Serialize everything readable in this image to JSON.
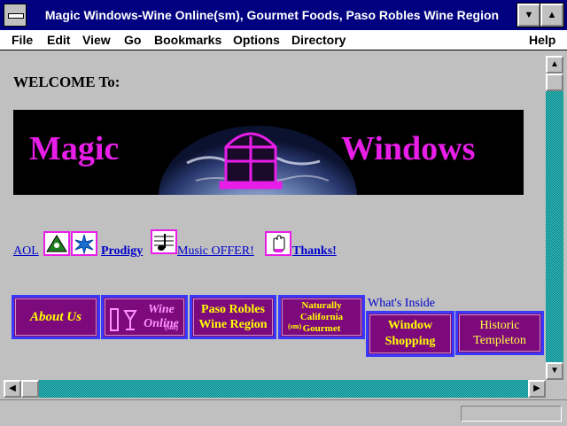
{
  "window": {
    "title": "Magic Windows-Wine Online(sm), Gourmet Foods, Paso Robles Wine Region"
  },
  "menu": {
    "items": [
      {
        "label": "File"
      },
      {
        "label": "Edit"
      },
      {
        "label": "View"
      },
      {
        "label": "Go"
      },
      {
        "label": "Bookmarks"
      },
      {
        "label": "Options"
      },
      {
        "label": "Directory"
      },
      {
        "label": "Help"
      }
    ]
  },
  "page": {
    "welcome": "WELCOME To:",
    "banner": {
      "left_word": "Magic",
      "right_word": "Windows"
    },
    "links": {
      "aol": "AOL",
      "prodigy": "Prodigy",
      "music_offer": "Music OFFER!",
      "thanks": "Thanks!"
    },
    "whats_inside": "What's Inside",
    "nav": {
      "about": "About Us",
      "wine_online": "Wine Online",
      "wine_online_sm": "(sm)",
      "paso_robles": "Paso Robles Wine Region",
      "naturally_california": "Naturally California Gourmet",
      "naturally_sm": "(sm)",
      "window_shopping": "Window Shopping",
      "historic_templeton": "Historic Templeton"
    }
  },
  "icons": {
    "system_menu": "system-menu-icon",
    "minimize": "minimize-icon",
    "maximize": "maximize-icon",
    "scroll_up": "arrow-up-icon",
    "scroll_down": "arrow-down-icon",
    "scroll_left": "arrow-left-icon",
    "scroll_right": "arrow-right-icon"
  },
  "colors": {
    "titlebar": "#000080",
    "link": "#0000cc",
    "magenta": "#e81ee8",
    "nav_bg": "#7d0a7d",
    "nav_text": "#ffff00"
  }
}
